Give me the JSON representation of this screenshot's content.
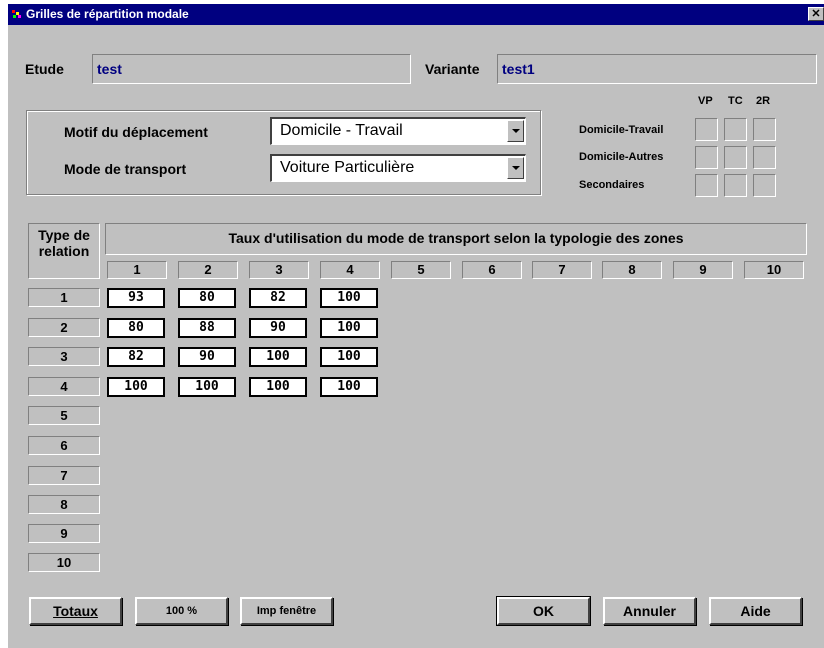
{
  "window": {
    "title": "Grilles de répartition modale",
    "close_glyph": "✕"
  },
  "etude": {
    "label": "Etude",
    "value": "test"
  },
  "variante": {
    "label": "Variante",
    "value": "test1"
  },
  "motif": {
    "label": "Motif du déplacement",
    "value": "Domicile - Travail"
  },
  "mode": {
    "label": "Mode de transport",
    "value": "Voiture Particulière"
  },
  "modes_header": [
    "VP",
    "TC",
    "2R"
  ],
  "purposes": [
    "Domicile-Travail",
    "Domicile-Autres",
    "Secondaires"
  ],
  "grid": {
    "row_header": "Type de relation",
    "col_header": "Taux d'utilisation du mode de transport selon la typologie des zones",
    "columns": [
      "1",
      "2",
      "3",
      "4",
      "5",
      "6",
      "7",
      "8",
      "9",
      "10"
    ],
    "rows": [
      "1",
      "2",
      "3",
      "4",
      "5",
      "6",
      "7",
      "8",
      "9",
      "10"
    ],
    "values": [
      [
        "93",
        "80",
        "82",
        "100"
      ],
      [
        "80",
        "88",
        "90",
        "100"
      ],
      [
        "82",
        "90",
        "100",
        "100"
      ],
      [
        "100",
        "100",
        "100",
        "100"
      ]
    ]
  },
  "buttons": {
    "totaux": "Totaux",
    "cent": "100 %",
    "imp": "Imp fenêtre",
    "ok": "OK",
    "annuler": "Annuler",
    "aide": "Aide"
  }
}
